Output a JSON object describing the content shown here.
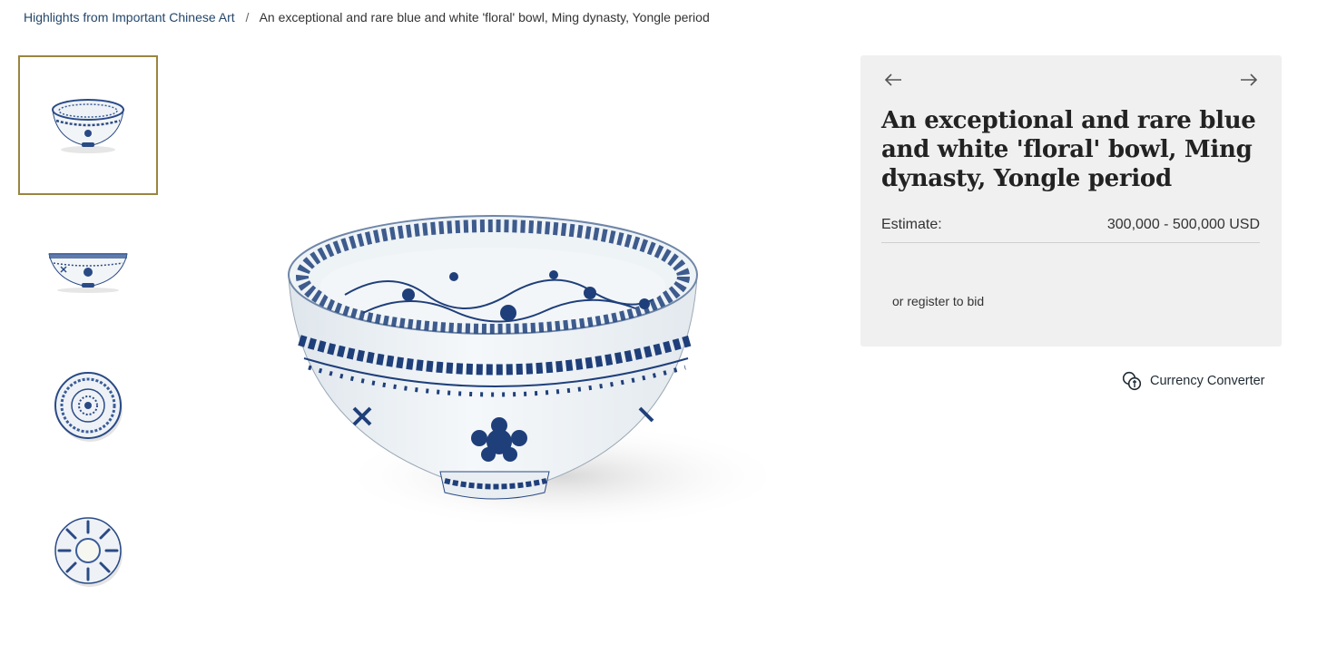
{
  "breadcrumb": {
    "parent": "Highlights from Important Chinese Art",
    "separator": "/",
    "current": "An exceptional and rare blue and white 'floral' bowl, Ming dynasty, Yongle period"
  },
  "thumbnails": [
    {
      "view": "bowl-three-quarter",
      "selected": true
    },
    {
      "view": "bowl-side",
      "selected": false
    },
    {
      "view": "bowl-interior",
      "selected": false
    },
    {
      "view": "bowl-base",
      "selected": false
    }
  ],
  "lot": {
    "title": "An exceptional and rare blue and white 'floral' bowl, Ming dynasty, Yongle period",
    "estimate_label": "Estimate:",
    "estimate_value": "300,000 - 500,000 USD",
    "register_text": "or register to bid",
    "prev_icon": "arrow-left-icon",
    "next_icon": "arrow-right-icon"
  },
  "currency": {
    "label": "Currency Converter",
    "icon": "currency-exchange-icon"
  },
  "colors": {
    "accent_border": "#9a8540",
    "link": "#24476b",
    "panel_bg": "#f0f0f0",
    "porcelain_blue": "#1f3f7a"
  }
}
